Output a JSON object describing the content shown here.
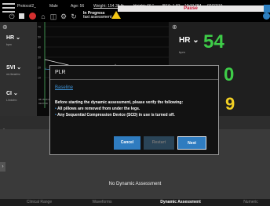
{
  "header": {
    "patient": "Protocol2_",
    "sex": "Male",
    "age": "Age: 56",
    "weight": "Weight: 154.35 lb",
    "height": "Height: 66 \"",
    "bsa": "BSA: 1.83",
    "time": "10:21 PM",
    "date": "02/27/19",
    "status_banner": "Pause",
    "status_line1": "In Progress",
    "status_line2": "fast assessment"
  },
  "left_params": [
    {
      "label": "HR",
      "unit": "bpm"
    },
    {
      "label": "SVI",
      "unit": "mL/beat/m²"
    },
    {
      "label": "CI",
      "unit": "L/min/m²"
    }
  ],
  "chart": {
    "y_ticks": [
      "70",
      "50",
      "40",
      "30",
      "20",
      "10"
    ],
    "marker_label": "40 ↓",
    "x_timestamp_1": "08:15:16 PM",
    "x_timestamp_2": "02/27/19"
  },
  "right_panel": {
    "hr_label": "HR",
    "hr_unit": "bpm",
    "hr_value": "54",
    "value_2": "0",
    "value_3": "9"
  },
  "modal": {
    "title": "PLR",
    "subtitle": "Baseline",
    "instruction": "Before starting the dynamic assessment, please verify the following:",
    "bullets": [
      "All pillows are removed from under the legs.",
      "Any Sequential Compression Device (SCD) in use is turned off."
    ],
    "cancel": "Cancel",
    "restart": "Restart",
    "next": "Next"
  },
  "main_message": "No Dynamic Assessment",
  "tabs": [
    "Clinical Range",
    "Waveforms",
    "Dynamic Assessment",
    "Numeric"
  ],
  "colors": {
    "accent_blue": "#2f7cc0",
    "value_green": "#3ecc48",
    "value_yellow": "#f2d024",
    "pause_red": "#c8102e"
  }
}
